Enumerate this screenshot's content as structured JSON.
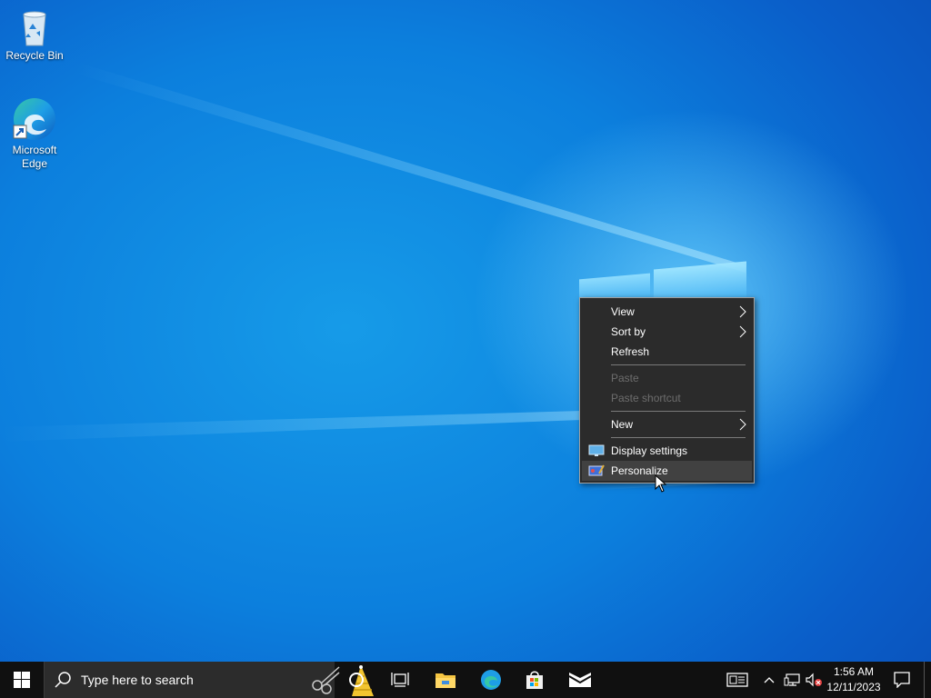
{
  "desktop": {
    "icons": [
      {
        "label_line1": "Recycle Bin",
        "label_line2": ""
      },
      {
        "label_line1": "Microsoft",
        "label_line2": "Edge"
      }
    ]
  },
  "context_menu": {
    "items": [
      {
        "label": "View",
        "has_submenu": true,
        "enabled": true
      },
      {
        "label": "Sort by",
        "has_submenu": true,
        "enabled": true
      },
      {
        "label": "Refresh",
        "has_submenu": false,
        "enabled": true
      },
      {
        "label": "Paste",
        "has_submenu": false,
        "enabled": false
      },
      {
        "label": "Paste shortcut",
        "has_submenu": false,
        "enabled": false
      },
      {
        "label": "New",
        "has_submenu": true,
        "enabled": true
      },
      {
        "label": "Display settings",
        "icon": "display-icon",
        "has_submenu": false,
        "enabled": true
      },
      {
        "label": "Personalize",
        "icon": "personalize-icon",
        "has_submenu": false,
        "enabled": true,
        "hovered": true
      }
    ],
    "submenu_arrow": ">"
  },
  "taskbar": {
    "search_placeholder": "Type here to search",
    "pinned": [
      "cortana-icon",
      "task-view-icon",
      "file-explorer-icon",
      "edge-icon",
      "store-icon",
      "mail-icon"
    ],
    "tray": [
      "news-icon",
      "show-hidden-icon",
      "network-icon",
      "volume-muted-icon"
    ],
    "clock": {
      "time": "1:56 AM",
      "date": "12/11/2023"
    }
  },
  "colors": {
    "accent": "#0a63d0",
    "menu_bg": "#2b2b2b",
    "taskbar_bg": "#101010"
  }
}
